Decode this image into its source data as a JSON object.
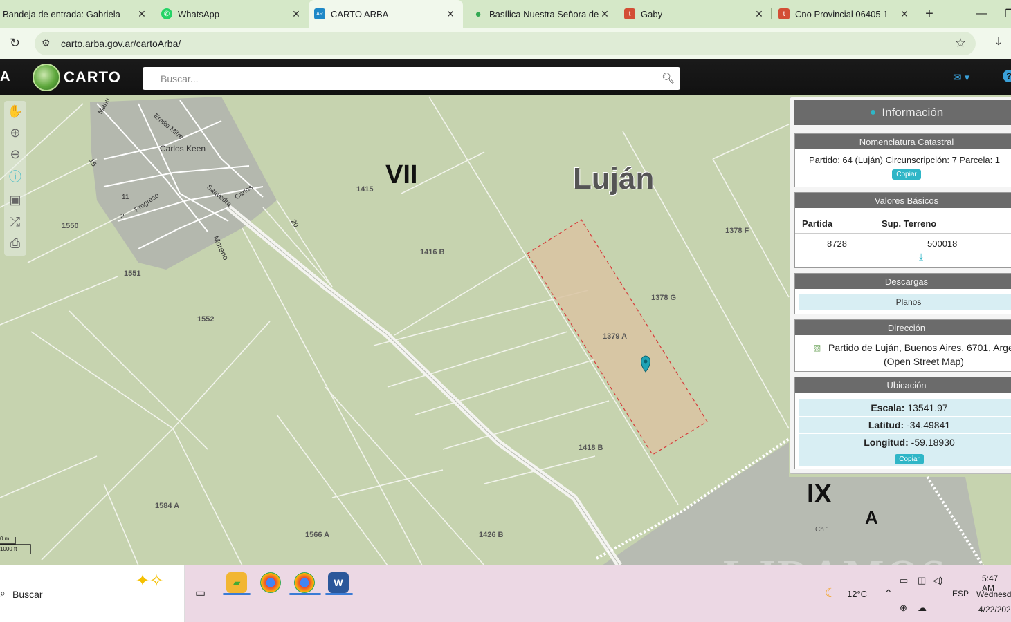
{
  "browser": {
    "tabs": [
      {
        "title": "Bandeja de entrada: Gabriela",
        "favicon": "gmail-icon",
        "color": "#c5221f"
      },
      {
        "title": "WhatsApp",
        "favicon": "whatsapp-icon",
        "color": "#25d366"
      },
      {
        "title": "CARTO ARBA",
        "favicon": "arba-icon",
        "color": "#1e88c7",
        "active": true
      },
      {
        "title": "Basílica Nuestra Señora de L",
        "favicon": "maps-pin-icon",
        "color": "#34a853"
      },
      {
        "title": "Gaby",
        "favicon": "tumblr-icon",
        "color": "#d34e35"
      },
      {
        "title": "Cno Provincial 06405 1",
        "favicon": "tumblr-icon",
        "color": "#d34e35"
      }
    ],
    "new_tab": "+",
    "url": "carto.arba.gov.ar/cartoArba/"
  },
  "app": {
    "partial_letter": "A",
    "brand": "CARTO",
    "search_placeholder": "Buscar..."
  },
  "map": {
    "big_labels": {
      "section_vii": "VII",
      "lujan": "Luján",
      "section_ix": "IX",
      "zone_a": "A"
    },
    "town": "Carlos Keen",
    "streets": [
      "Emilio Mitre",
      "Moreno",
      "Progreso",
      "Carlos",
      "15",
      "20",
      "Saavedra",
      "11",
      "2",
      "Manu"
    ],
    "parcels": [
      "1415",
      "1550",
      "1551",
      "1552",
      "1416 B",
      "1378 F",
      "1378 G",
      "1379 A",
      "1418 B",
      "1584 A",
      "1566 A",
      "1426 B",
      "Ch 1"
    ],
    "scale": {
      "metric": "0 m",
      "imperial": "1000 ft"
    },
    "watermark": "LJRAMOS"
  },
  "info_panel": {
    "title": "Información",
    "nomenclatura": {
      "header": "Nomenclatura Catastral",
      "text": "Partido: 64 (Luján) Circunscripción: 7 Parcela: 1",
      "copy": "Copiar"
    },
    "valores": {
      "header": "Valores Básicos",
      "col_partida": "Partida",
      "col_sup": "Sup. Terreno",
      "partida": "8728",
      "sup": "500018"
    },
    "descargas": {
      "header": "Descargas",
      "planos": "Planos"
    },
    "direccion": {
      "header": "Dirección",
      "line1": "Partido de Luján, Buenos Aires, 6701, Arge",
      "line2": "(Open Street Map)"
    },
    "ubicacion": {
      "header": "Ubicación",
      "escala_label": "Escala:",
      "escala": "13541.97",
      "latitud_label": "Latitud:",
      "latitud": "-34.49841",
      "longitud_label": "Longitud:",
      "longitud": "-59.18930",
      "copy": "Copiar"
    }
  },
  "taskbar": {
    "search": "Buscar",
    "weather": "12°C",
    "lang": "ESP",
    "time": "5:47 AM",
    "day": "Wednesd",
    "date": "4/22/202"
  }
}
